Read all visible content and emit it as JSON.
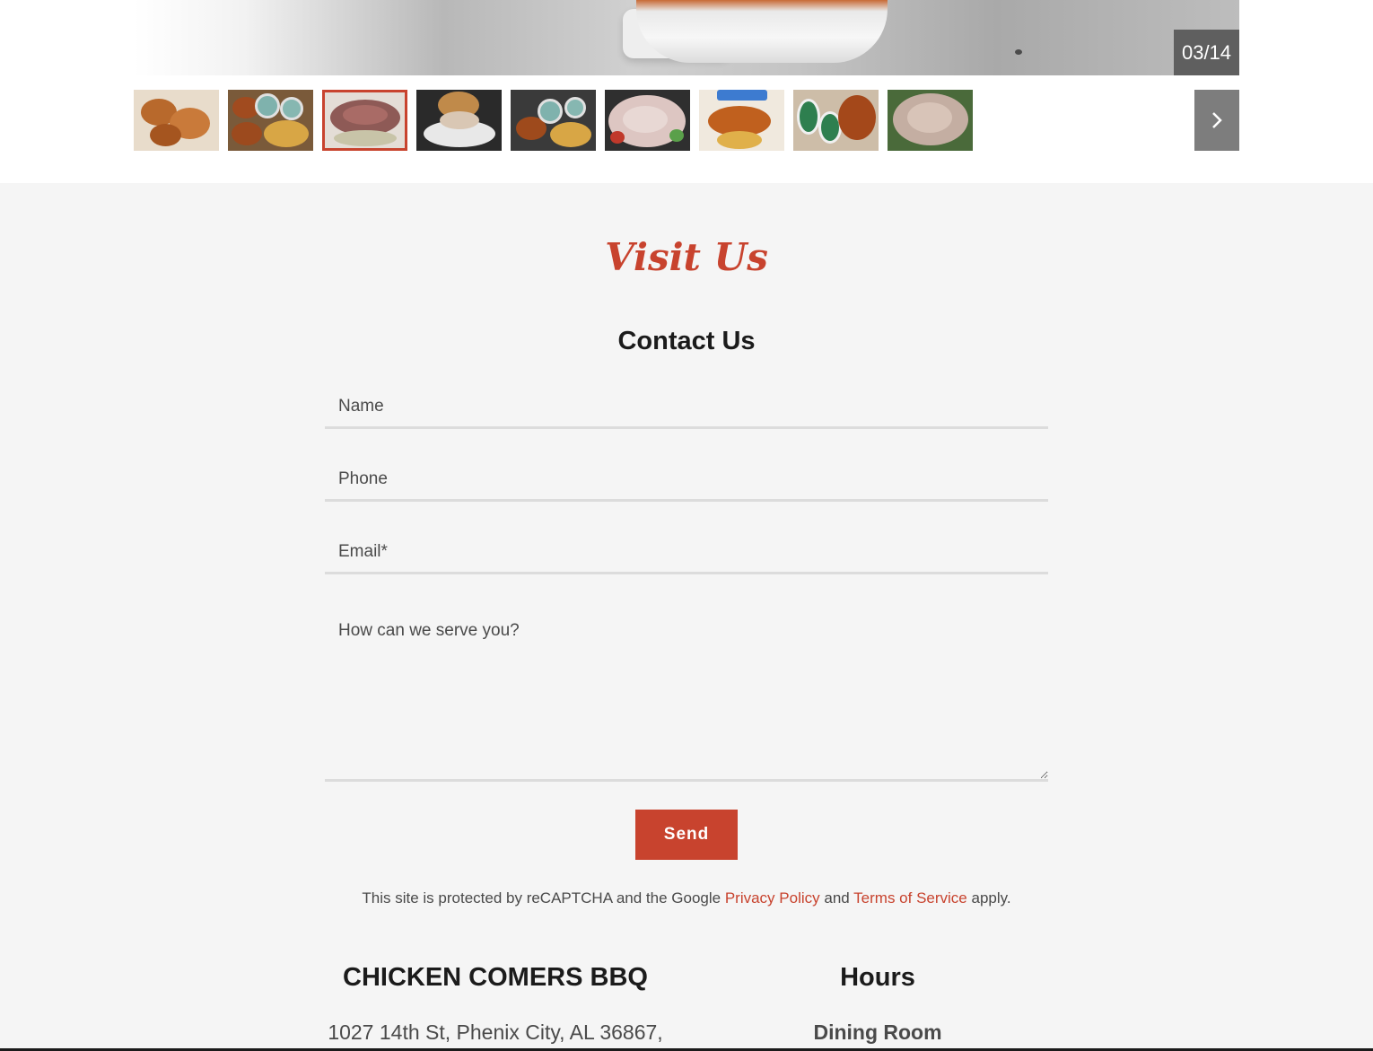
{
  "gallery": {
    "counter": "03/14",
    "thumbnails": [
      {
        "alt": "fried-chicken-wings",
        "active": false
      },
      {
        "alt": "wings-and-fries-platter",
        "active": false
      },
      {
        "alt": "sliced-roast-beef",
        "active": true
      },
      {
        "alt": "pulled-pork-sandwich",
        "active": false
      },
      {
        "alt": "wings-fries-dips-platter",
        "active": false
      },
      {
        "alt": "chopped-chicken-salad",
        "active": false
      },
      {
        "alt": "buffalo-wings-fries",
        "active": false
      },
      {
        "alt": "wings-with-ranch",
        "active": false
      },
      {
        "alt": "pulled-chicken",
        "active": false
      }
    ],
    "next_icon": "chevron-right-icon"
  },
  "contact": {
    "section_title": "Visit Us",
    "form_title": "Contact Us",
    "name_placeholder": "Name",
    "phone_placeholder": "Phone",
    "email_placeholder": "Email*",
    "message_placeholder": "How can we serve you?",
    "send_label": "Send",
    "recaptcha_prefix": "This site is protected by reCAPTCHA and the Google",
    "privacy_link": "Privacy Policy",
    "and_text": "and",
    "terms_link": "Terms of Service",
    "recaptcha_suffix": "apply."
  },
  "business": {
    "name": "CHICKEN COMERS BBQ",
    "address": "1027 14th St, Phenix City, AL 36867,",
    "hours_title": "Hours",
    "hours_subtitle": "Dining Room"
  },
  "colors": {
    "accent": "#c8432e",
    "background": "#f5f5f5",
    "counter_bg": "#5f5f5f",
    "next_bg": "#7d7d7d"
  }
}
